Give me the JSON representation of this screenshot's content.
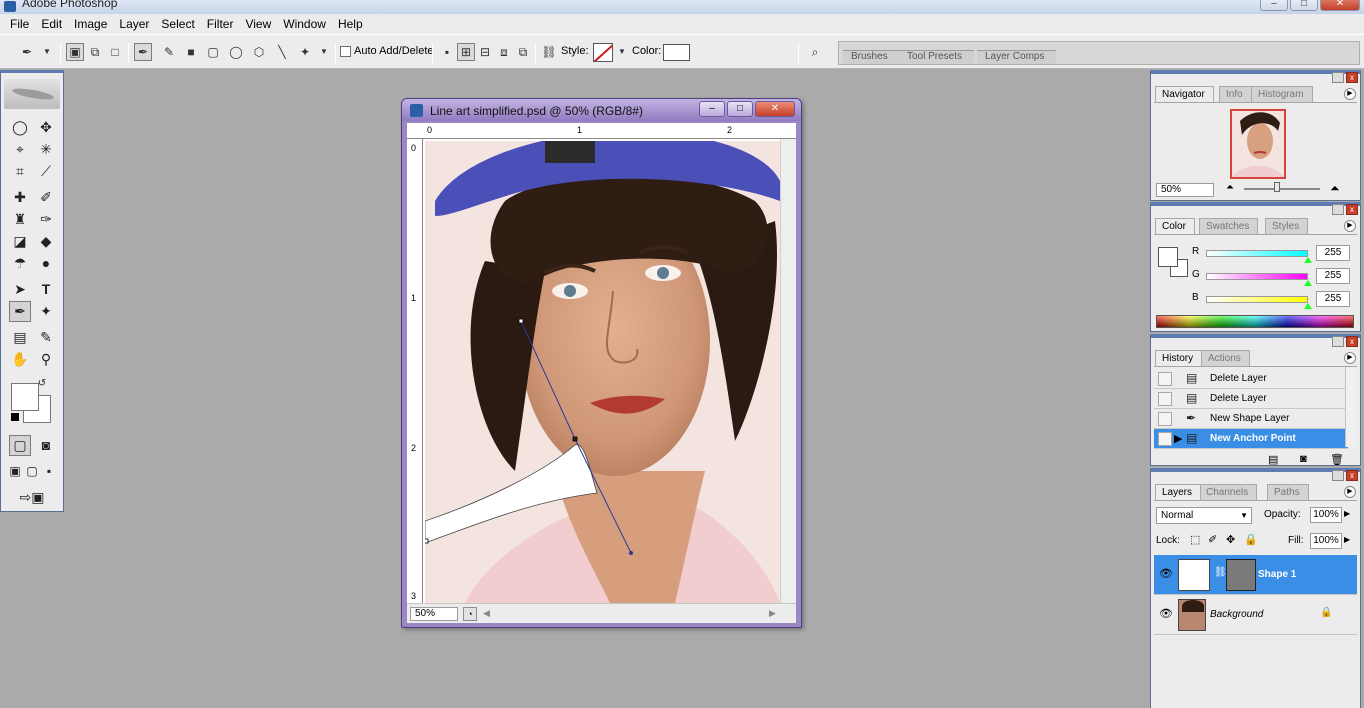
{
  "app": {
    "title": "Adobe Photoshop"
  },
  "window_controls": {
    "minimize": "–",
    "maximize": "□",
    "close": "✕"
  },
  "menu": [
    "File",
    "Edit",
    "Image",
    "Layer",
    "Select",
    "Filter",
    "View",
    "Window",
    "Help"
  ],
  "options_bar": {
    "auto_add_delete": "Auto Add/Delete",
    "style_label": "Style:",
    "color_label": "Color:",
    "palette_well_tabs": [
      "Brushes",
      "Tool Presets",
      "Layer Comps"
    ]
  },
  "document": {
    "title": "Line art simplified.psd @ 50% (RGB/8#)",
    "zoom": "50%",
    "ruler_top": [
      "0",
      "1",
      "2"
    ],
    "ruler_left": [
      "0",
      "1",
      "2",
      "3"
    ]
  },
  "navigator": {
    "tabs": [
      "Navigator",
      "Info",
      "Histogram"
    ],
    "zoom": "50%"
  },
  "color_panel": {
    "tabs": [
      "Color",
      "Swatches",
      "Styles"
    ],
    "channels": [
      {
        "label": "R",
        "value": "255",
        "from": "#ffffff",
        "to": "#00ffff"
      },
      {
        "label": "G",
        "value": "255",
        "from": "#ffffff",
        "to": "#ff00ff"
      },
      {
        "label": "B",
        "value": "255",
        "from": "#ffffff",
        "to": "#ffff00"
      }
    ]
  },
  "history_panel": {
    "tabs": [
      "History",
      "Actions"
    ],
    "items": [
      "Delete Layer",
      "Delete Layer",
      "New Shape Layer",
      "New Anchor Point"
    ],
    "selected_index": 3
  },
  "layers_panel": {
    "tabs": [
      "Layers",
      "Channels",
      "Paths"
    ],
    "blend_mode": "Normal",
    "opacity_label": "Opacity:",
    "opacity": "100%",
    "lock_label": "Lock:",
    "fill_label": "Fill:",
    "fill": "100%",
    "layers": [
      "Shape 1",
      "Background"
    ]
  },
  "colors": {
    "selection": "#3a8ee6",
    "doc_frame": "#9a88c4",
    "palette_header": "#5d7db2"
  }
}
